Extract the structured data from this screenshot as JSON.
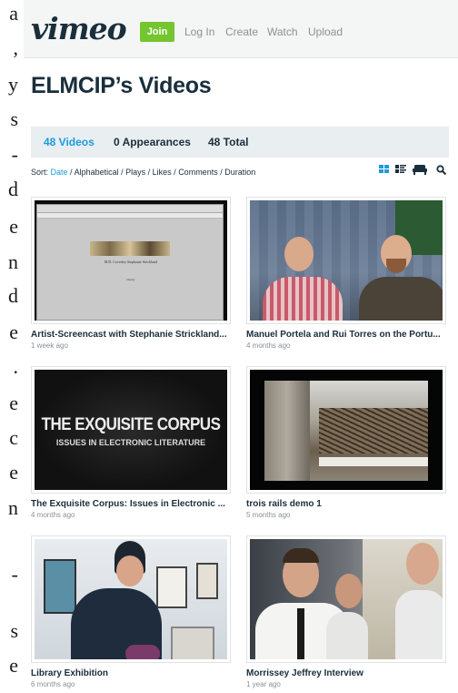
{
  "left_strip": [
    "a",
    ",",
    "y",
    "s",
    "-",
    "d",
    "e",
    "n",
    "d",
    "e",
    ".",
    "e",
    "c",
    "e",
    "n",
    "-",
    "s",
    "e"
  ],
  "header": {
    "logo": "vimeo",
    "join_label": "Join",
    "nav": [
      "Log In",
      "Create",
      "Watch",
      "Upload"
    ]
  },
  "page_title": "ELMCIP’s Videos",
  "tabs": [
    {
      "label": "48 Videos",
      "active": true
    },
    {
      "label": "0 Appearances",
      "active": false
    },
    {
      "label": "48 Total",
      "active": false
    }
  ],
  "sort": {
    "prefix": "Sort:",
    "options": [
      "Date",
      "Alphabetical",
      "Plays",
      "Likes",
      "Comments",
      "Duration"
    ],
    "active": "Date"
  },
  "view_icons": [
    "grid-view-icon",
    "detail-view-icon",
    "couch-mode-icon",
    "search-icon"
  ],
  "videos": [
    {
      "title": "Artist-Screencast with Stephanie Strickland...",
      "meta": "1 week ago",
      "thumb": "screencast"
    },
    {
      "title": "Manuel Portela and Rui Torres on the Portu...",
      "meta": "4 months ago",
      "thumb": "two-men"
    },
    {
      "title": "The Exquisite Corpus: Issues in Electronic ...",
      "meta": "4 months ago",
      "thumb": "exquisite",
      "thumb_text": [
        "THE EXQUISITE CORPUS",
        "ISSUES IN ELECTRONIC LITERATURE"
      ]
    },
    {
      "title": "trois rails demo 1",
      "meta": "5 months ago",
      "thumb": "rails"
    },
    {
      "title": "Library Exhibition",
      "meta": "6 months ago",
      "thumb": "library"
    },
    {
      "title": "Morrissey Jeffrey Interview",
      "meta": "1 year ago",
      "thumb": "interview"
    }
  ],
  "screencast_caption": [
    "M.D. Coverley   Stephanie Strickland",
    "Display"
  ],
  "colors": {
    "accent": "#1a9bdc",
    "join": "#74c52f",
    "text": "#1a2e3b",
    "muted": "#8a9196"
  }
}
